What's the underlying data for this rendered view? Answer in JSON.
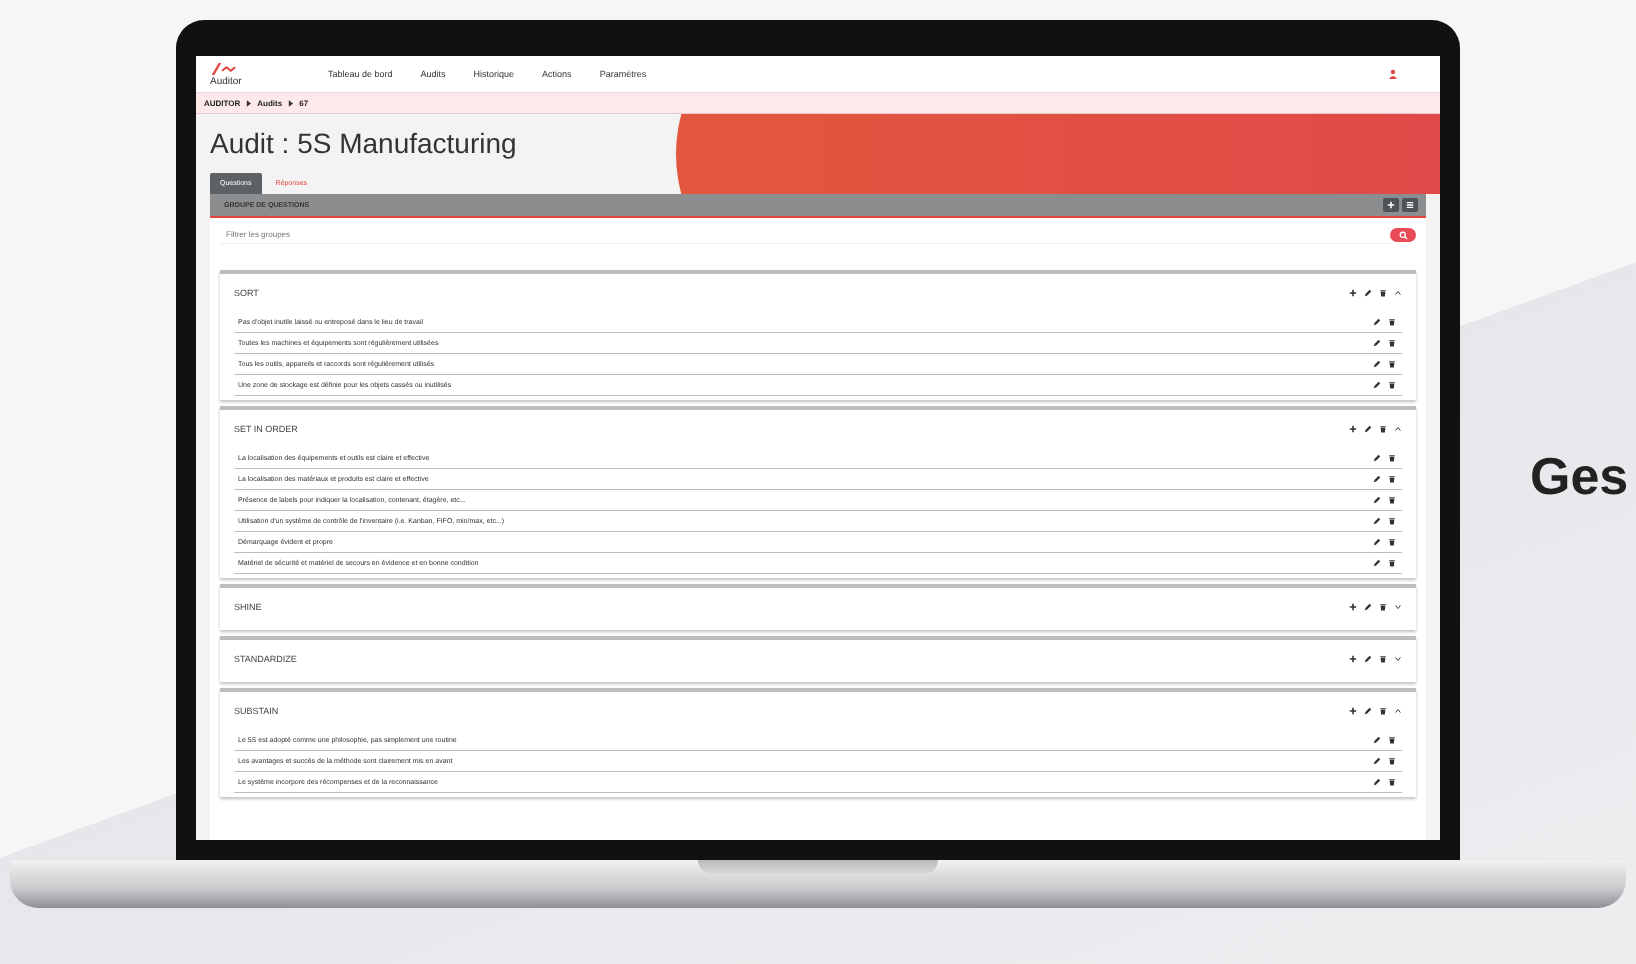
{
  "nav": {
    "logo": "Auditor",
    "items": [
      "Tableau de bord",
      "Audits",
      "Historique",
      "Actions",
      "Paramètres"
    ]
  },
  "breadcrumb": [
    "AUDITOR",
    "Audits",
    "67"
  ],
  "title": "Audit : 5S Manufacturing",
  "tabs": [
    {
      "label": "Questions",
      "selected": true
    },
    {
      "label": "Réponses",
      "selected": false
    }
  ],
  "panel": {
    "title": "GROUPE DE QUESTIONS"
  },
  "filter": {
    "placeholder": "Filtrer les groupes"
  },
  "groups": [
    {
      "name": "SORT",
      "expanded": true,
      "questions": [
        "Pas d'objet inutile laissé ou entreposé dans le lieu de travail",
        "Toutes les machines et équipements sont régulièrement utilisées",
        "Tous les outils, appareils et raccords sont régulièrement utilisés",
        "Une zone de stockage est définie pour les objets cassés ou inutilisés"
      ]
    },
    {
      "name": "SET IN ORDER",
      "expanded": true,
      "questions": [
        "La localisation des équipements et outils est claire et effective",
        "La localisation des matériaux et produits est claire et effective",
        "Présence de labels pour indiquer la localisation, contenant, étagère, etc...",
        "Utilisation d'un système de contrôle de l'inventaire (i.e. Kanban, FIFO, min/max, etc...)",
        "Démarquage évident et propre",
        "Matériel de sécurité et matériel de secours en évidence et en bonne condition"
      ]
    },
    {
      "name": "SHINE",
      "expanded": false
    },
    {
      "name": "STANDARDIZE",
      "expanded": false
    },
    {
      "name": "SUBSTAIN",
      "expanded": true,
      "questions": [
        "Le 5S est adopté comme une philosophie, pas simplement une routine",
        "Les avantages et succès de la méthode sont clairement mis en avant",
        "Le système incorpore des récompenses et de la reconnaissance"
      ]
    }
  ],
  "tagline": "Ges"
}
